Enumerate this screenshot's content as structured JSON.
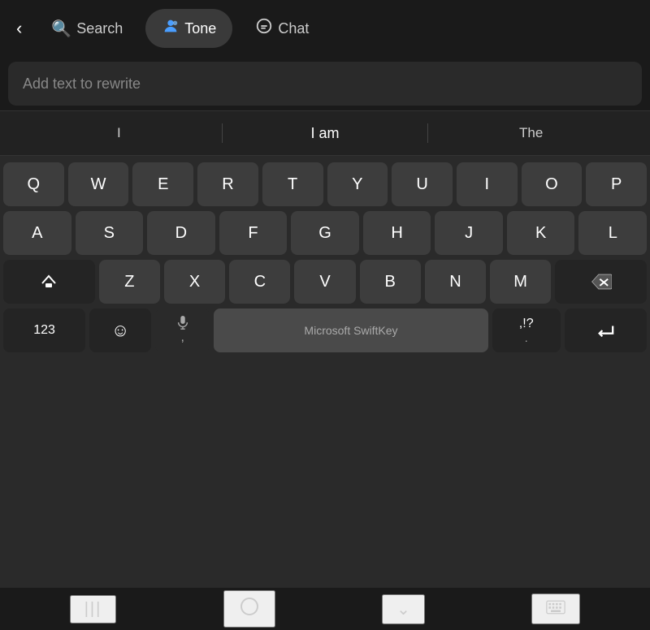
{
  "nav": {
    "back_icon": "‹",
    "tabs": [
      {
        "id": "search",
        "label": "Search",
        "icon": "🔍",
        "active": false
      },
      {
        "id": "tone",
        "label": "Tone",
        "icon": "👤",
        "active": true
      },
      {
        "id": "chat",
        "label": "Chat",
        "icon": "💬",
        "active": false
      }
    ]
  },
  "input": {
    "placeholder": "Add text to rewrite"
  },
  "suggestions": [
    {
      "id": "left",
      "text": "I",
      "main": false
    },
    {
      "id": "center",
      "text": "I am",
      "main": true
    },
    {
      "id": "right",
      "text": "The",
      "main": false
    }
  ],
  "keyboard": {
    "rows": [
      [
        "Q",
        "W",
        "E",
        "R",
        "T",
        "Y",
        "U",
        "I",
        "O",
        "P"
      ],
      [
        "A",
        "S",
        "D",
        "F",
        "G",
        "H",
        "J",
        "K",
        "L"
      ],
      [
        "Z",
        "X",
        "C",
        "V",
        "B",
        "N",
        "M"
      ]
    ],
    "num_label": "123",
    "space_label": "Microsoft SwiftKey",
    "punctuation_label": ",!?",
    "period_label": "."
  },
  "bottom_nav": {
    "menu_icon": "|||",
    "home_icon": "○",
    "back_icon": "∨",
    "keyboard_icon": "⊞"
  }
}
